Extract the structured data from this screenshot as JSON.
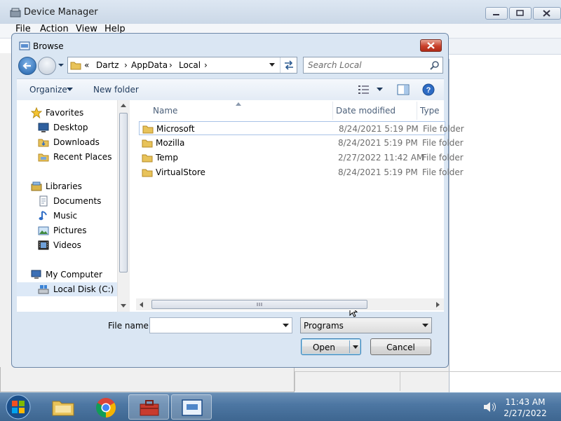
{
  "background_window": {
    "title": "Device Manager",
    "menu": [
      "File",
      "Action",
      "View",
      "Help"
    ]
  },
  "dialog": {
    "title": "Browse",
    "address": {
      "overflow": "«",
      "segments": [
        "Dartz",
        "AppData",
        "Local"
      ]
    },
    "search_placeholder": "Search Local",
    "toolbar": {
      "organize": "Organize",
      "new_folder": "New folder"
    },
    "nav": {
      "favorites": "Favorites",
      "desktop": "Desktop",
      "downloads": "Downloads",
      "recent_places": "Recent Places",
      "libraries": "Libraries",
      "documents": "Documents",
      "music": "Music",
      "pictures": "Pictures",
      "videos": "Videos",
      "my_computer": "My Computer",
      "local_disk": "Local Disk (C:)"
    },
    "columns": {
      "name": "Name",
      "date": "Date modified",
      "type": "Type"
    },
    "files": [
      {
        "name": "Microsoft",
        "date": "8/24/2021 5:19 PM",
        "type": "File folder"
      },
      {
        "name": "Mozilla",
        "date": "8/24/2021 5:19 PM",
        "type": "File folder"
      },
      {
        "name": "Temp",
        "date": "2/27/2022 11:42 AM",
        "type": "File folder"
      },
      {
        "name": "VirtualStore",
        "date": "8/24/2021 5:19 PM",
        "type": "File folder"
      }
    ],
    "file_name_label": "File name:",
    "file_name_value": "",
    "file_type": "Programs",
    "open_label": "Open",
    "cancel_label": "Cancel"
  },
  "taskbar": {
    "time": "11:43 AM",
    "date": "2/27/2022"
  },
  "colors": {
    "title_bar": "#dae6f3",
    "close_red": "#c9402b",
    "folder_yellow": "#e8c35a",
    "taskbar": "#4d77a3"
  }
}
